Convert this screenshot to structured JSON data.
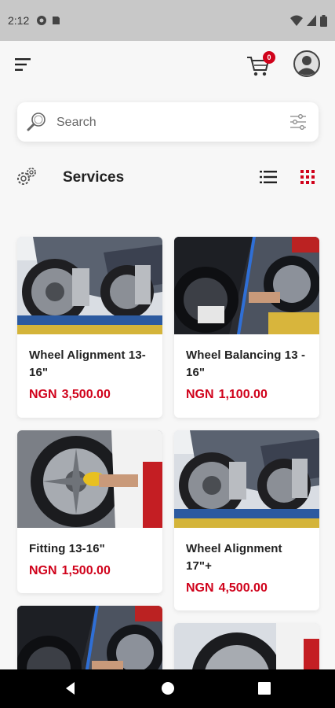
{
  "status_bar": {
    "time": "2:12",
    "icons": [
      "media-icon",
      "sd-card-icon",
      "wifi-icon",
      "signal-icon",
      "battery-icon"
    ]
  },
  "header": {
    "cart_count": "0",
    "icons": [
      "menu-icon",
      "cart-icon",
      "profile-icon"
    ]
  },
  "search": {
    "placeholder": "Search"
  },
  "section": {
    "title": "Services"
  },
  "colors": {
    "accent": "#d0021b",
    "background": "#f7f7f7",
    "card": "#ffffff"
  },
  "products": [
    {
      "name": "Wheel Alignment 13-16\"",
      "currency": "NGN",
      "price": "3,500.00"
    },
    {
      "name": "Wheel Balancing 13 - 16\"",
      "currency": "NGN",
      "price": "1,100.00"
    },
    {
      "name": "Fitting 13-16\"",
      "currency": "NGN",
      "price": "1,500.00"
    },
    {
      "name": "Wheel Alignment 17\"+",
      "currency": "NGN",
      "price": "4,500.00"
    },
    {
      "name": "",
      "currency": "",
      "price": ""
    },
    {
      "name": "",
      "currency": "",
      "price": ""
    }
  ]
}
